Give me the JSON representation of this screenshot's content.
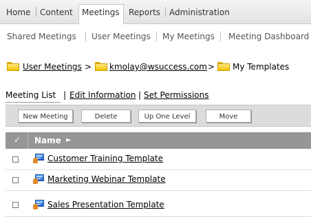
{
  "top_nav": {
    "items": [
      "Home",
      "Content",
      "Meetings",
      "Reports",
      "Administration"
    ],
    "active": "Meetings"
  },
  "sub_nav": {
    "items": [
      "Shared Meetings",
      "User Meetings",
      "My Meetings",
      "Meeting Dashboard"
    ]
  },
  "breadcrumb": {
    "items": [
      "User Meetings",
      "kmolay@wsuccess.com",
      "My Templates"
    ],
    "separator": ">"
  },
  "tabs": {
    "items": [
      "Meeting List",
      "Edit Information",
      "Set Permissions"
    ],
    "separator": "|",
    "active": "Meeting List"
  },
  "toolbar": {
    "buttons": [
      "New Meeting",
      "Delete",
      "Up One Level",
      "Move"
    ]
  },
  "grid": {
    "header_check": "✓",
    "header_name": "Name",
    "sort_glyph": "►",
    "rows": [
      {
        "name": "Customer Training Template",
        "icon": "meeting-template-icon"
      },
      {
        "name": "Marketing Webinar Template",
        "icon": "meeting-template-icon"
      },
      {
        "name": "Sales Presentation Template",
        "icon": "meeting-template-icon"
      }
    ]
  },
  "colors": {
    "grid_header": "#969696",
    "toolbar_bg": "#dcdcdc",
    "folder": "#f4c400"
  }
}
